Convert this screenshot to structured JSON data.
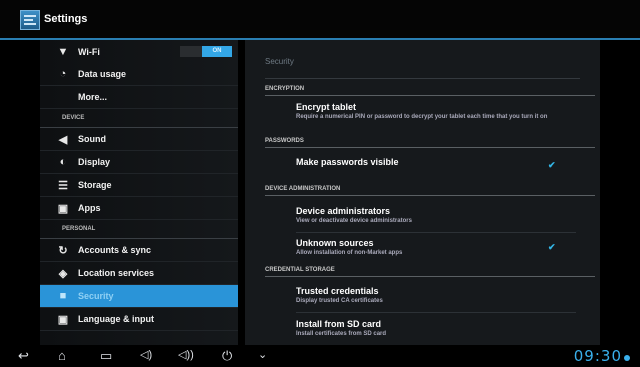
{
  "header": {
    "title": "Settings"
  },
  "sidebar": {
    "wifi": {
      "label": "Wi-Fi",
      "toggle_state": "ON"
    },
    "data_usage": "Data usage",
    "more": "More...",
    "device_header": "DEVICE",
    "sound": "Sound",
    "display": "Display",
    "storage": "Storage",
    "apps": "Apps",
    "personal_header": "PERSONAL",
    "accounts": "Accounts & sync",
    "location": "Location services",
    "security": "Security",
    "language": "Language & input"
  },
  "main": {
    "title": "Security",
    "encryption_header": "ENCRYPTION",
    "encrypt": {
      "title": "Encrypt tablet",
      "summary": "Require a numerical PIN or password to decrypt your tablet each time that you turn it on"
    },
    "passwords_header": "PASSWORDS",
    "make_visible": {
      "title": "Make passwords visible",
      "checked": true
    },
    "device_admin_header": "DEVICE ADMINISTRATION",
    "device_admins": {
      "title": "Device administrators",
      "summary": "View or deactivate device administrators"
    },
    "unknown_sources": {
      "title": "Unknown sources",
      "summary": "Allow installation of non-Market apps",
      "checked": true
    },
    "credential_header": "CREDENTIAL STORAGE",
    "trusted": {
      "title": "Trusted credentials",
      "summary": "Display trusted CA certificates"
    },
    "install_sd": {
      "title": "Install from SD card",
      "summary": "Install certificates from SD card"
    }
  },
  "navbar": {
    "clock": "09:30"
  },
  "colors": {
    "accent": "#33b5e5",
    "selected_bg": "#2a94d8"
  }
}
